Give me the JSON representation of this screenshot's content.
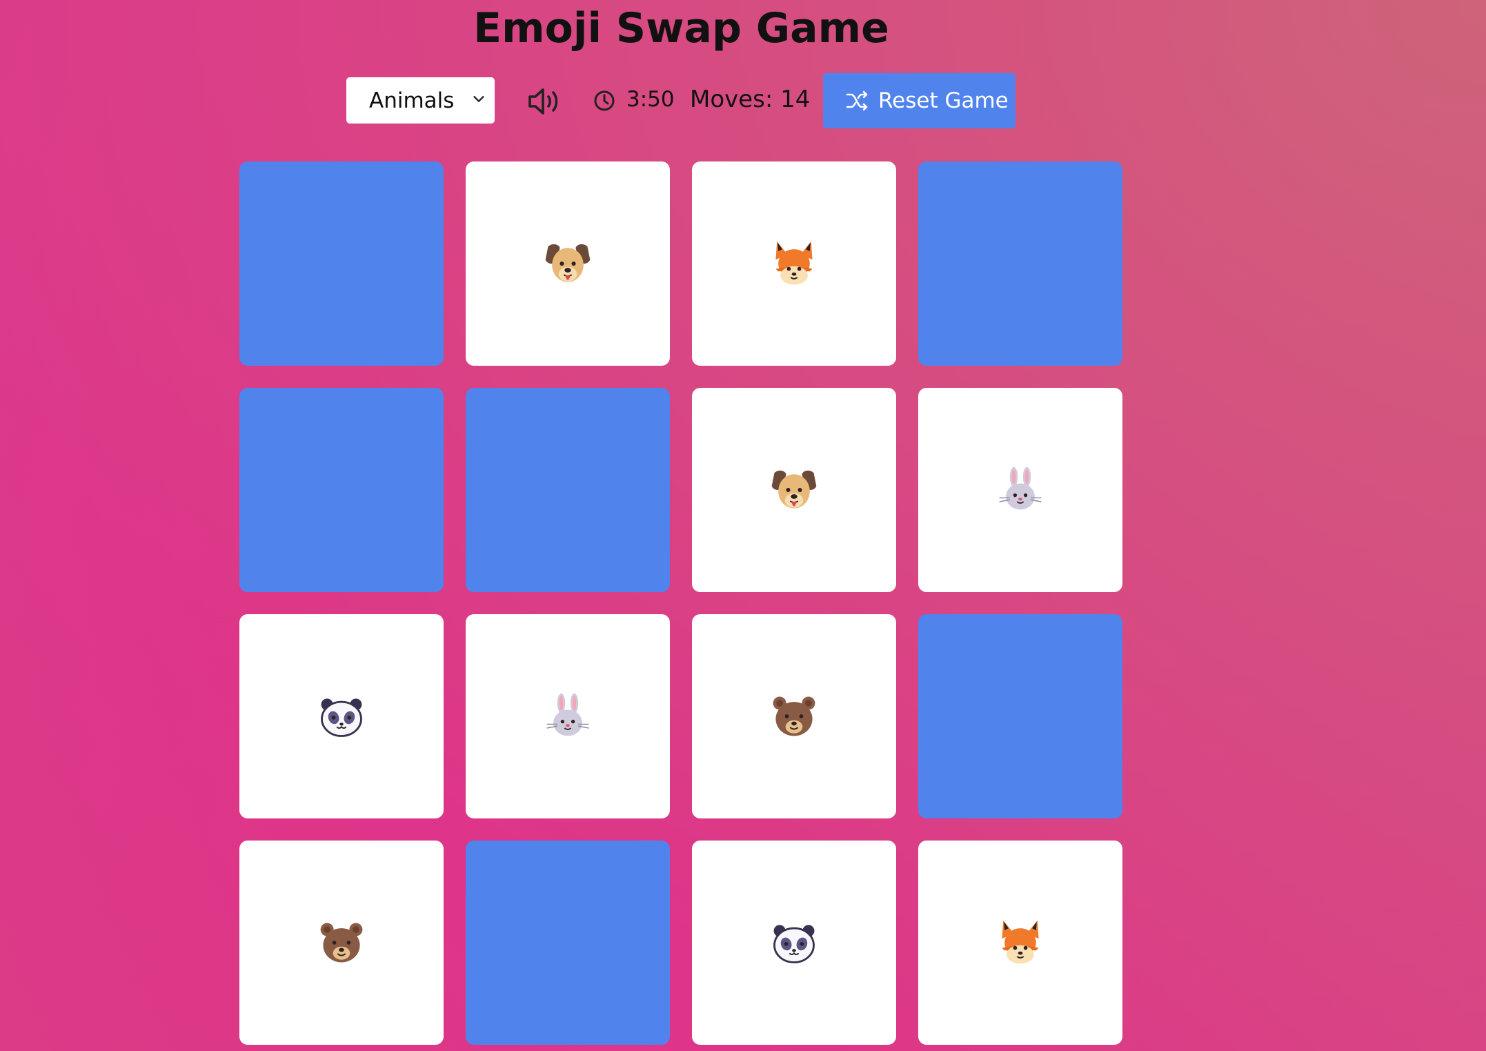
{
  "title": "Emoji Swap Game",
  "controls": {
    "category": "Animals",
    "sound_icon": "volume-icon",
    "clock_icon": "clock-icon",
    "timer": "3:50",
    "moves_label": "Moves: 14",
    "reset_label": "Reset Game",
    "reset_icon": "shuffle-icon"
  },
  "colors": {
    "card_back": "#5183ed",
    "card_face": "#ffffff",
    "button": "#5183ed"
  },
  "cards": [
    {
      "state": "hidden",
      "emoji": null
    },
    {
      "state": "revealed",
      "emoji": "dog-face-icon"
    },
    {
      "state": "revealed",
      "emoji": "fox-face-icon"
    },
    {
      "state": "hidden",
      "emoji": null
    },
    {
      "state": "hidden",
      "emoji": null
    },
    {
      "state": "hidden",
      "emoji": null
    },
    {
      "state": "revealed",
      "emoji": "dog-face-icon"
    },
    {
      "state": "revealed",
      "emoji": "rabbit-face-icon"
    },
    {
      "state": "revealed",
      "emoji": "panda-face-icon"
    },
    {
      "state": "revealed",
      "emoji": "rabbit-face-icon"
    },
    {
      "state": "revealed",
      "emoji": "bear-face-icon"
    },
    {
      "state": "hidden",
      "emoji": null
    },
    {
      "state": "revealed",
      "emoji": "bear-face-icon"
    },
    {
      "state": "hidden",
      "emoji": null
    },
    {
      "state": "revealed",
      "emoji": "panda-face-icon"
    },
    {
      "state": "revealed",
      "emoji": "fox-face-icon"
    }
  ]
}
